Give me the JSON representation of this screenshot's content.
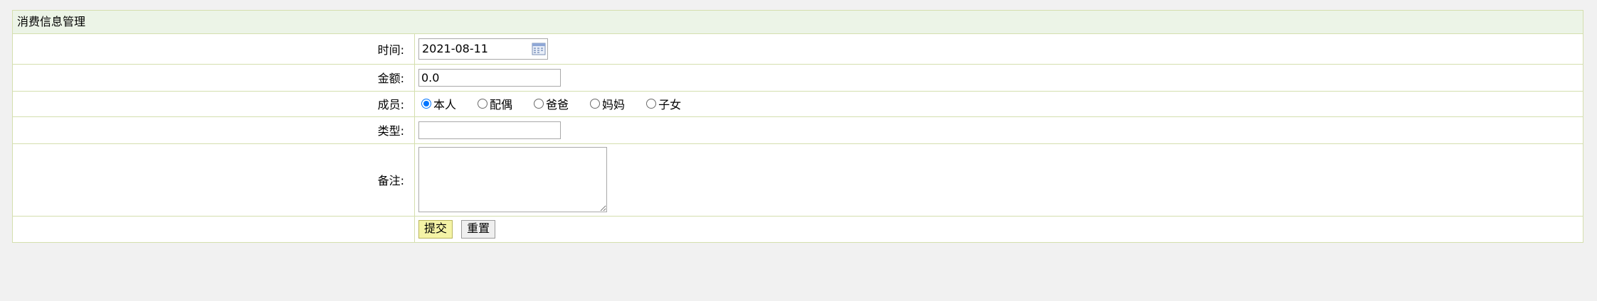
{
  "panel": {
    "title": "消费信息管理"
  },
  "form": {
    "time": {
      "label": "时间:",
      "value": "2021-08-11"
    },
    "amount": {
      "label": "金额:",
      "value": "0.0"
    },
    "member": {
      "label": "成员:",
      "options": [
        "本人",
        "配偶",
        "爸爸",
        "妈妈",
        "子女"
      ],
      "selected": "本人"
    },
    "type": {
      "label": "类型:",
      "value": ""
    },
    "note": {
      "label": "备注:",
      "value": ""
    }
  },
  "buttons": {
    "submit": "提交",
    "reset": "重置"
  },
  "icons": {
    "date_picker": "calendar-icon"
  },
  "colors": {
    "page_bg": "#f1f1f1",
    "panel_border": "#d4dfae",
    "title_bg": "#ecf4e7",
    "submit_bg": "#f4f3a6",
    "radio_accent": "#0075ff"
  }
}
